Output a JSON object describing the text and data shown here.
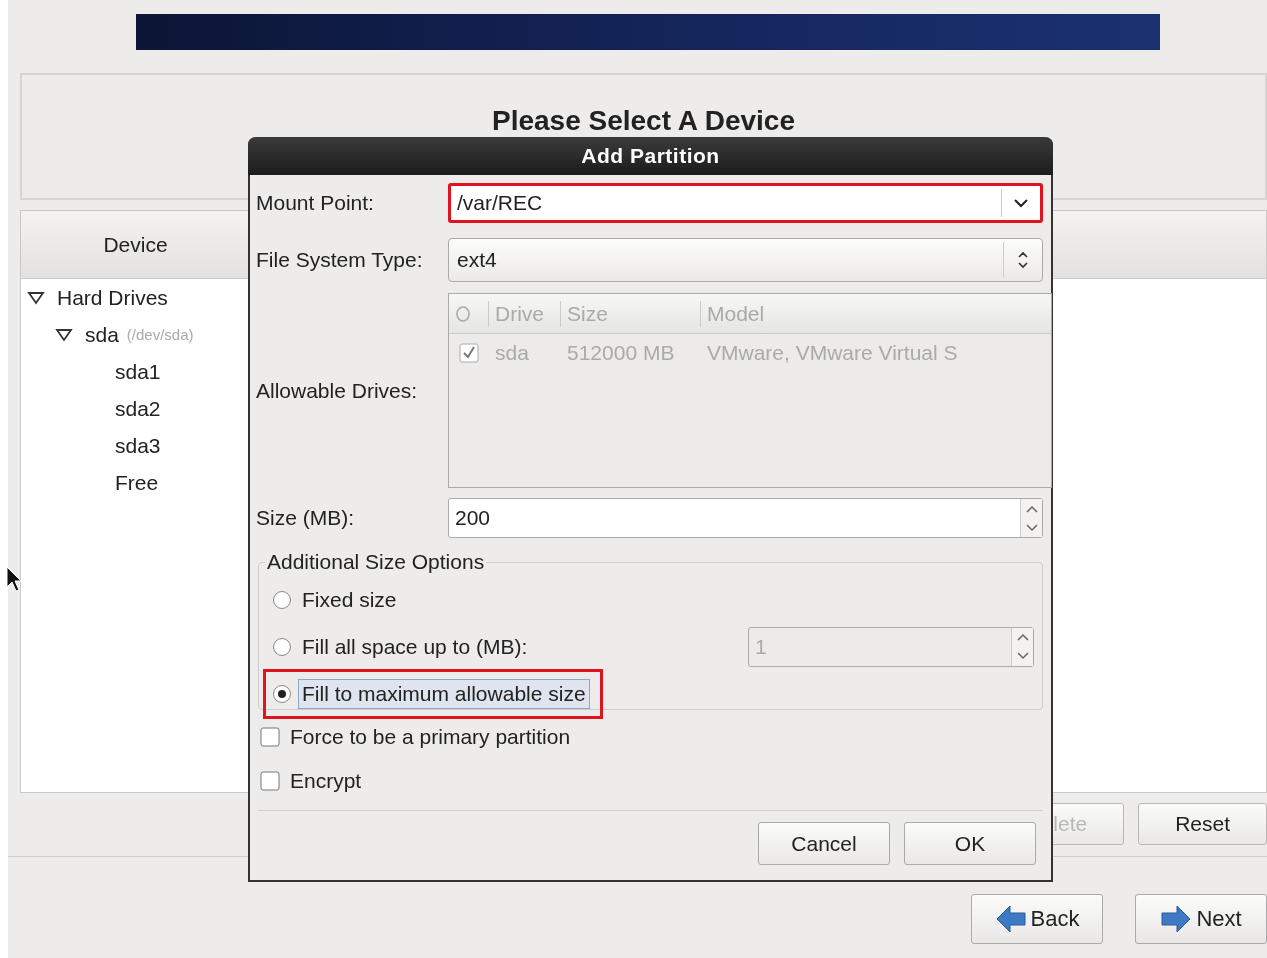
{
  "background": {
    "heading": "Please Select A Device",
    "device_column": "Device",
    "tree": [
      {
        "label": "Hard Drives",
        "expanded": true,
        "children": [
          {
            "label": "sda",
            "detail": "(/dev/sda)",
            "expanded": true,
            "children": [
              {
                "label": "sda1"
              },
              {
                "label": "sda2"
              },
              {
                "label": "sda3"
              },
              {
                "label": "Free"
              }
            ]
          }
        ]
      }
    ],
    "action_buttons": [
      {
        "label": "lete",
        "disabled": true
      },
      {
        "label": "Reset",
        "disabled": false
      }
    ],
    "nav_buttons": [
      {
        "label": "Back",
        "kind": "back"
      },
      {
        "label": "Next",
        "kind": "next"
      }
    ]
  },
  "dialog": {
    "title": "Add Partition",
    "mount_point": {
      "label": "Mount Point:",
      "value": "/var/REC",
      "highlighted": true
    },
    "file_system_type": {
      "label": "File System Type:",
      "value": "ext4"
    },
    "allowable_drives": {
      "label": "Allowable Drives:",
      "disabled": true,
      "columns": [
        "Drive",
        "Size",
        "Model"
      ],
      "rows": [
        {
          "checked": true,
          "cells": [
            "sda",
            "512000 MB",
            "VMware, VMware Virtual S"
          ]
        }
      ]
    },
    "size": {
      "label": "Size (MB):",
      "value": "200"
    },
    "size_options": {
      "legend": "Additional Size Options",
      "options": [
        {
          "kind": "plain",
          "label": "Fixed size",
          "selected": false,
          "highlighted": false
        },
        {
          "kind": "with_field",
          "label": "Fill all space up to (MB):",
          "selected": false,
          "highlighted": false,
          "field_value": "1",
          "field_disabled": true
        },
        {
          "kind": "plain",
          "label": "Fill to maximum allowable size",
          "selected": true,
          "highlighted": true
        }
      ]
    },
    "checkboxes": [
      {
        "label": "Force to be a primary partition",
        "checked": false
      },
      {
        "label": "Encrypt",
        "checked": false
      }
    ],
    "buttons": [
      "Cancel",
      "OK"
    ]
  }
}
